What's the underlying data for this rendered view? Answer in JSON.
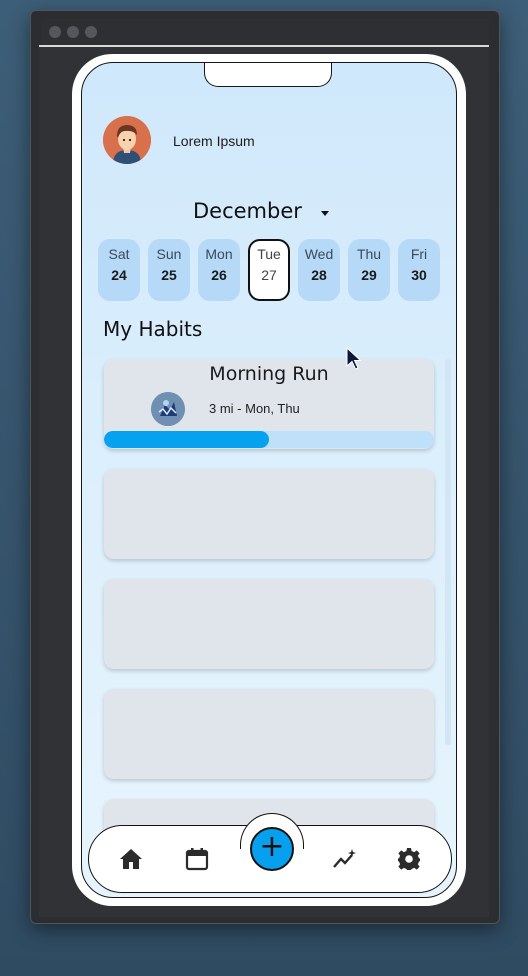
{
  "profile": {
    "name": "Lorem Ipsum",
    "avatar_icon": "user-avatar-icon"
  },
  "calendar": {
    "month": "December",
    "days": [
      {
        "name": "Sat",
        "num": "24",
        "selected": false
      },
      {
        "name": "Sun",
        "num": "25",
        "selected": false
      },
      {
        "name": "Mon",
        "num": "26",
        "selected": false
      },
      {
        "name": "Tue",
        "num": "27",
        "selected": true
      },
      {
        "name": "Wed",
        "num": "28",
        "selected": false
      },
      {
        "name": "Thu",
        "num": "29",
        "selected": false
      },
      {
        "name": "Fri",
        "num": "30",
        "selected": false
      }
    ]
  },
  "habits_section": {
    "title": "My Habits"
  },
  "habits": [
    {
      "title": "Morning Run",
      "detail": "3 mi - Mon, Thu",
      "progress": 0.5
    },
    {
      "title": "",
      "detail": ""
    },
    {
      "title": "",
      "detail": ""
    },
    {
      "title": "",
      "detail": ""
    },
    {
      "title": "",
      "detail": ""
    }
  ],
  "nav": {
    "items": [
      {
        "icon": "home-icon"
      },
      {
        "icon": "calendar-icon"
      },
      {
        "icon": "add-icon",
        "label": "+"
      },
      {
        "icon": "stats-icon"
      },
      {
        "icon": "settings-icon"
      }
    ]
  },
  "colors": {
    "accent": "#06a0ef",
    "day_pill": "#b5d9f7",
    "card": "#e0e5ec",
    "progress_track": "#bfe0fb",
    "background_top": "#cfe8fb"
  }
}
